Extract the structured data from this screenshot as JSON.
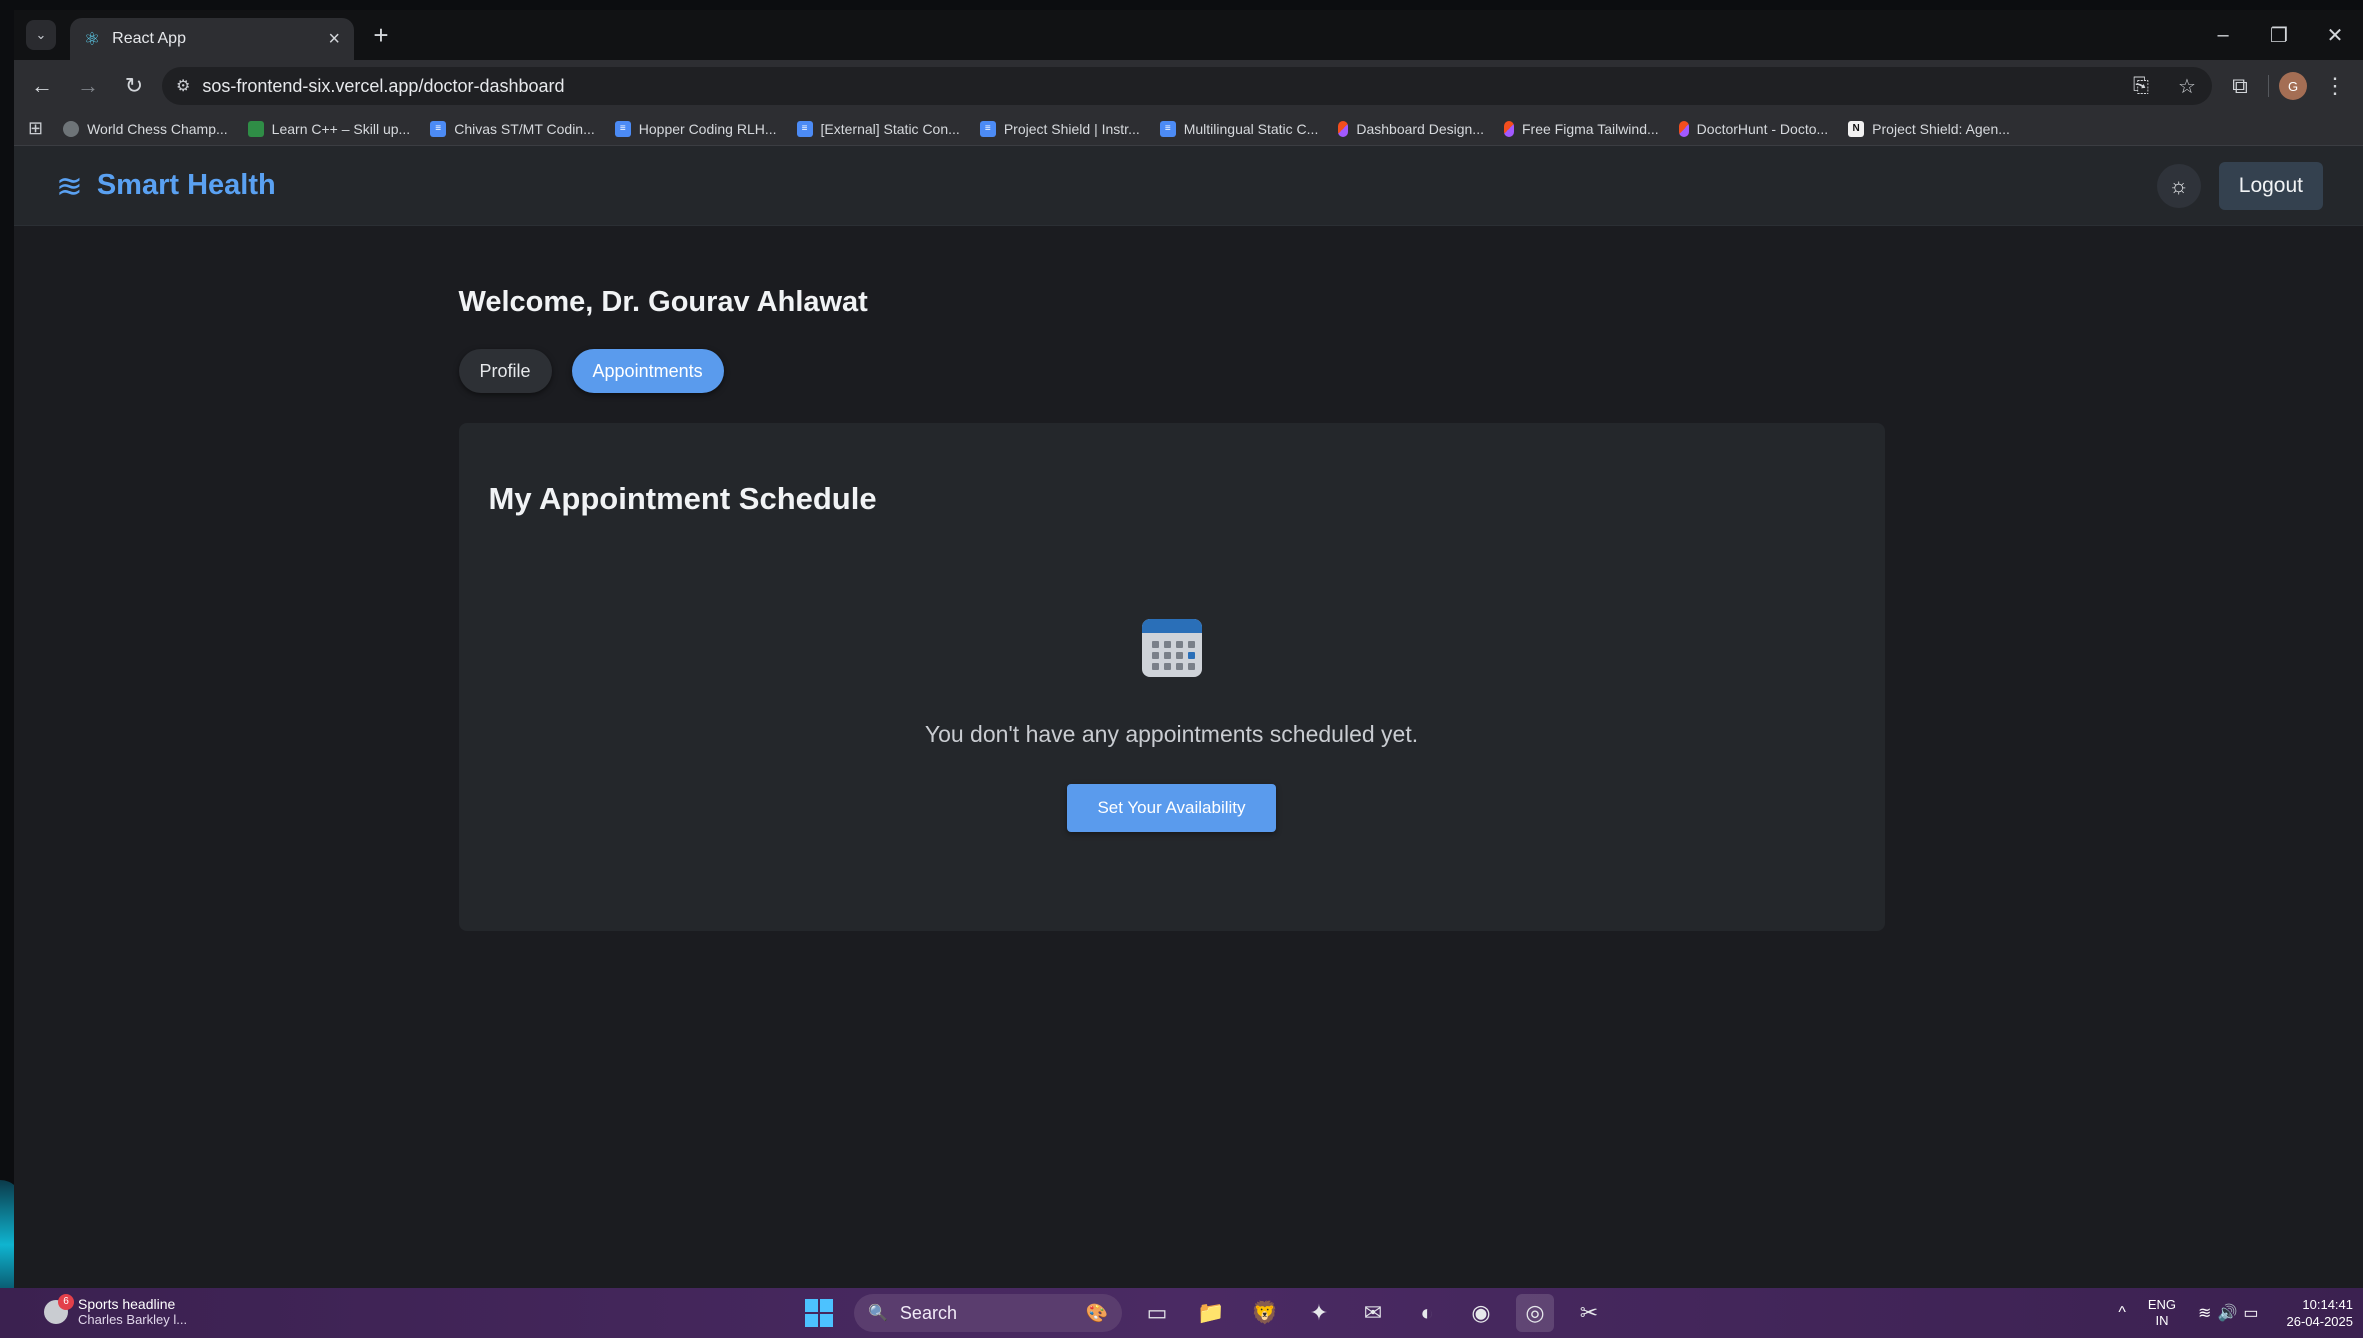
{
  "browser": {
    "tab_title": "React App",
    "new_tab": "+",
    "url": "sos-frontend-six.vercel.app/doctor-dashboard",
    "bookmarks": [
      {
        "label": "World Chess Champ...",
        "icon": "chess"
      },
      {
        "label": "Learn C++ – Skill up...",
        "icon": "gfg"
      },
      {
        "label": "Chivas ST/MT Codin...",
        "icon": "doc"
      },
      {
        "label": "Hopper Coding RLH...",
        "icon": "doc"
      },
      {
        "label": "[External] Static Con...",
        "icon": "doc"
      },
      {
        "label": "Project Shield | Instr...",
        "icon": "doc"
      },
      {
        "label": "Multilingual Static C...",
        "icon": "doc"
      },
      {
        "label": "Dashboard Design...",
        "icon": "figma"
      },
      {
        "label": "Free Figma Tailwind...",
        "icon": "figma"
      },
      {
        "label": "DoctorHunt - Docto...",
        "icon": "figma"
      },
      {
        "label": "Project Shield: Agen...",
        "icon": "notion"
      }
    ],
    "profile_initial": "G"
  },
  "app": {
    "brand": "Smart Health",
    "logout_label": "Logout",
    "welcome": "Welcome, Dr. Gourav Ahlawat",
    "tabs": {
      "profile": "Profile",
      "appointments": "Appointments"
    },
    "active_tab": "appointments",
    "card": {
      "title": "My Appointment Schedule",
      "empty_message": "You don't have any appointments scheduled yet.",
      "cta_label": "Set Your Availability"
    },
    "colors": {
      "accent": "#5a9bed",
      "brand": "#5aa1f2",
      "card_bg": "#24272b",
      "page_bg": "#1b1c20"
    }
  },
  "taskbar": {
    "weather_badge": "6",
    "news_title": "Sports headline",
    "news_sub": "Charles Barkley l...",
    "search_label": "Search",
    "lang_top": "ENG",
    "lang_bottom": "IN",
    "time": "10:14:41",
    "date": "26-04-2025"
  }
}
